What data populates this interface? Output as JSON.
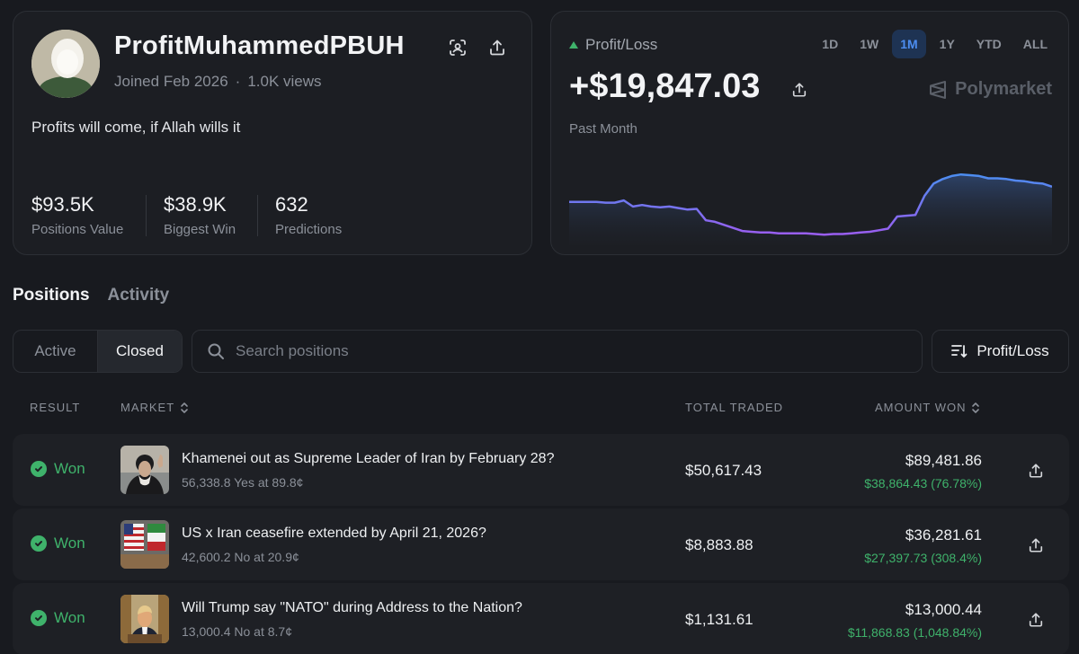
{
  "profile": {
    "username": "ProfitMuhammedPBUH",
    "joined": "Joined Feb 2026",
    "views": "1.0K views",
    "dot": "·",
    "bio": "Profits will come, if Allah wills it",
    "stats": [
      {
        "value": "$93.5K",
        "label": "Positions Value"
      },
      {
        "value": "$38.9K",
        "label": "Biggest Win"
      },
      {
        "value": "632",
        "label": "Predictions"
      }
    ]
  },
  "pnl": {
    "label": "Profit/Loss",
    "ranges": [
      "1D",
      "1W",
      "1M",
      "1Y",
      "YTD",
      "ALL"
    ],
    "active_range": "1M",
    "value": "+$19,847.03",
    "brand": "Polymarket",
    "period": "Past Month",
    "chart_data": {
      "type": "area",
      "series": [
        {
          "values": [
            0.52,
            0.52,
            0.52,
            0.52,
            0.51,
            0.51,
            0.54,
            0.46,
            0.48,
            0.46,
            0.45,
            0.46,
            0.44,
            0.42,
            0.43,
            0.28,
            0.26,
            0.22,
            0.18,
            0.14,
            0.13,
            0.12,
            0.12,
            0.11,
            0.11,
            0.11,
            0.11,
            0.1,
            0.09,
            0.1,
            0.1,
            0.11,
            0.12,
            0.13,
            0.15,
            0.17,
            0.33,
            0.34,
            0.35,
            0.6,
            0.76,
            0.82,
            0.86,
            0.88,
            0.87,
            0.86,
            0.83,
            0.83,
            0.82,
            0.8,
            0.79,
            0.77,
            0.76,
            0.72
          ]
        }
      ],
      "colors": {
        "high": "#4c8df0",
        "low": "#9a5ef0"
      }
    }
  },
  "tabs": [
    {
      "label": "Positions",
      "active": true
    },
    {
      "label": "Activity",
      "active": false
    }
  ],
  "filters": {
    "segments": [
      "Active",
      "Closed"
    ],
    "active_segment": "Closed",
    "search_placeholder": "Search positions",
    "sort_label": "Profit/Loss"
  },
  "table": {
    "headers": {
      "result": "RESULT",
      "market": "MARKET",
      "total_traded": "TOTAL TRADED",
      "amount_won": "AMOUNT WON"
    },
    "rows": [
      {
        "result": "Won",
        "title": "Khamenei out as Supreme Leader of Iran by February 28?",
        "sub": "56,338.8 Yes at 89.8¢",
        "traded": "$50,617.43",
        "won": "$89,481.86",
        "gain": "$38,864.43 (76.78%)"
      },
      {
        "result": "Won",
        "title": "US x Iran ceasefire extended by April 21, 2026?",
        "sub": "42,600.2 No at 20.9¢",
        "traded": "$8,883.88",
        "won": "$36,281.61",
        "gain": "$27,397.73 (308.4%)"
      },
      {
        "result": "Won",
        "title": "Will Trump say \"NATO\" during Address to the Nation?",
        "sub": "13,000.4 No at 8.7¢",
        "traded": "$1,131.61",
        "won": "$13,000.44",
        "gain": "$11,868.83 (1,048.84%)"
      }
    ]
  },
  "colors": {
    "accent": "#4c8df0",
    "positive": "#3fb26b",
    "background": "#181a1f",
    "card": "#1c1e23"
  },
  "icons": [
    "scan-face-icon",
    "share-icon",
    "polymarket-logo-icon",
    "search-icon",
    "sort-icon",
    "chevron-updown-icon",
    "check-circle-icon"
  ]
}
